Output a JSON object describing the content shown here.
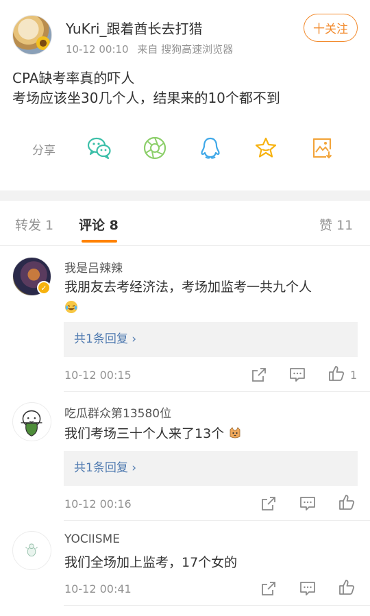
{
  "post": {
    "username": "YuKri_跟着酋长去打猎",
    "time": "10-12 00:10",
    "source": "来自 搜狗高速浏览器",
    "follow_label": "十关注",
    "text_line1": "CPA缺考率真的吓人",
    "text_line2": "考场应该坐30几个人，结果来的10个都不到",
    "share_label": "分享",
    "share_icons": [
      "wechat-icon",
      "moments-icon",
      "qq-icon",
      "favorite-star-icon",
      "save-image-icon"
    ]
  },
  "tabs": {
    "repost": "转发 1",
    "comments": "评论 8",
    "likes": "赞 11"
  },
  "comments": [
    {
      "name": "我是吕辣辣",
      "text_line1": "我朋友去考经济法，考场加监考一共九个人",
      "reply": "共1条回复 ›",
      "time": "10-12 00:15",
      "likes": "1",
      "verified": true
    },
    {
      "name": "吃瓜群众第13580位",
      "text": "我们考场三十个人来了13个",
      "reply": "共1条回复 ›",
      "time": "10-12 00:16"
    },
    {
      "name": "YOCIISME",
      "text": "我们全场加上监考，17个女的",
      "time": "10-12 00:41"
    }
  ],
  "colors": {
    "accent": "#ff8200",
    "follow": "#f28a2c",
    "link": "#4f7ab0",
    "muted": "#939393",
    "wechat": "#3bbfa8",
    "moments": "#8ccf6a",
    "qq": "#3fa8e8",
    "star": "#f7b20f",
    "save": "#f2a43a"
  }
}
